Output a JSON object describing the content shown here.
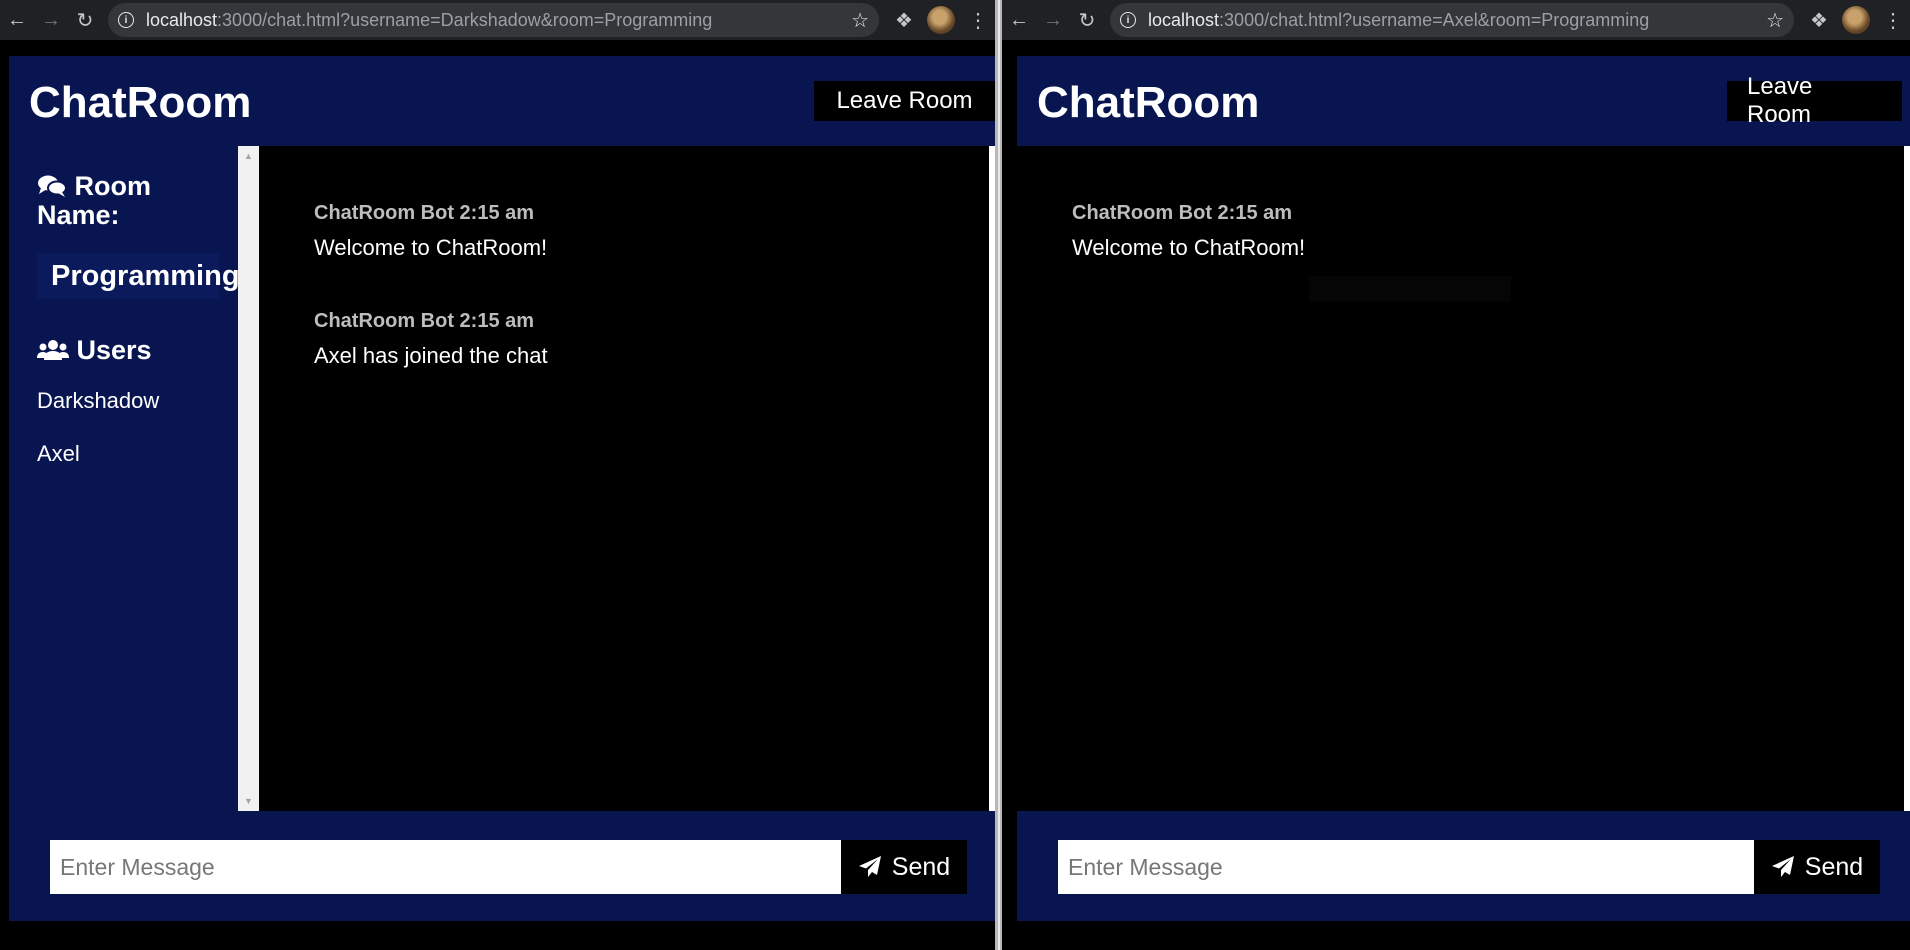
{
  "left_window": {
    "url_host": "localhost",
    "url_rest": ":3000/chat.html?username=Darkshadow&room=Programming",
    "app_title": "ChatRoom",
    "leave_button": "Leave Room",
    "sidebar": {
      "room_heading": "Room Name:",
      "room_name": "Programming",
      "users_heading": "Users",
      "users": [
        "Darkshadow",
        "Axel"
      ]
    },
    "messages": [
      {
        "meta": "ChatRoom Bot 2:15 am",
        "text": "Welcome to ChatRoom!"
      },
      {
        "meta": "ChatRoom Bot 2:15 am",
        "text": "Axel has joined the chat"
      }
    ],
    "composer": {
      "placeholder": "Enter Message",
      "send_label": "Send"
    }
  },
  "right_window": {
    "url_host": "localhost",
    "url_rest": ":3000/chat.html?username=Axel&room=Programming",
    "app_title": "ChatRoom",
    "leave_button": "Leave Room",
    "messages": [
      {
        "meta": "ChatRoom Bot 2:15 am",
        "text": "Welcome to ChatRoom!"
      }
    ],
    "composer": {
      "placeholder": "Enter Message",
      "send_label": "Send"
    }
  },
  "colors": {
    "app_background": "#081550",
    "chat_background": "#000000",
    "browser_toolbar": "#202124",
    "omnibox": "#35363a"
  }
}
